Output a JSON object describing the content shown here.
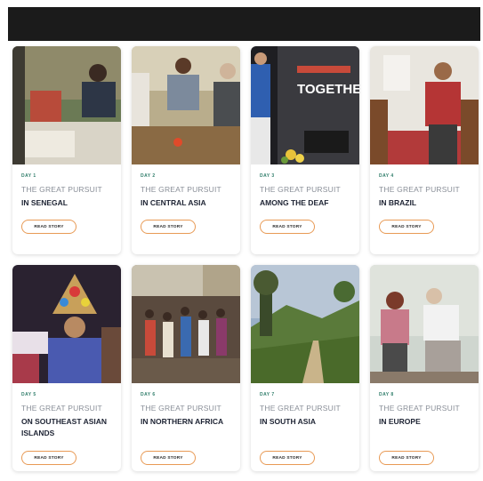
{
  "stories": [
    {
      "day": "DAY 1",
      "label": "THE GREAT PURSUIT",
      "place": "IN SENEGAL",
      "button": "READ STORY"
    },
    {
      "day": "DAY 2",
      "label": "THE GREAT PURSUIT",
      "place": "IN CENTRAL ASIA",
      "button": "READ STORY"
    },
    {
      "day": "DAY 3",
      "label": "THE GREAT PURSUIT",
      "place": "AMONG THE DEAF",
      "button": "READ STORY",
      "sign": "TOGETHER"
    },
    {
      "day": "DAY 4",
      "label": "THE GREAT PURSUIT",
      "place": "IN BRAZIL",
      "button": "READ STORY"
    },
    {
      "day": "DAY 5",
      "label": "THE GREAT PURSUIT",
      "place": "ON SOUTHEAST ASIAN ISLANDS",
      "button": "READ STORY"
    },
    {
      "day": "DAY 6",
      "label": "THE GREAT PURSUIT",
      "place": "IN NORTHERN AFRICA",
      "button": "READ STORY"
    },
    {
      "day": "DAY 7",
      "label": "THE GREAT PURSUIT",
      "place": "IN SOUTH ASIA",
      "button": "READ STORY"
    },
    {
      "day": "DAY 8",
      "label": "THE GREAT PURSUIT",
      "place": "IN EUROPE",
      "button": "READ STORY"
    }
  ],
  "colors": {
    "accent": "#e89a55",
    "day": "#2f7d6a",
    "title": "#1d2333",
    "header": "#1b1b1b"
  }
}
